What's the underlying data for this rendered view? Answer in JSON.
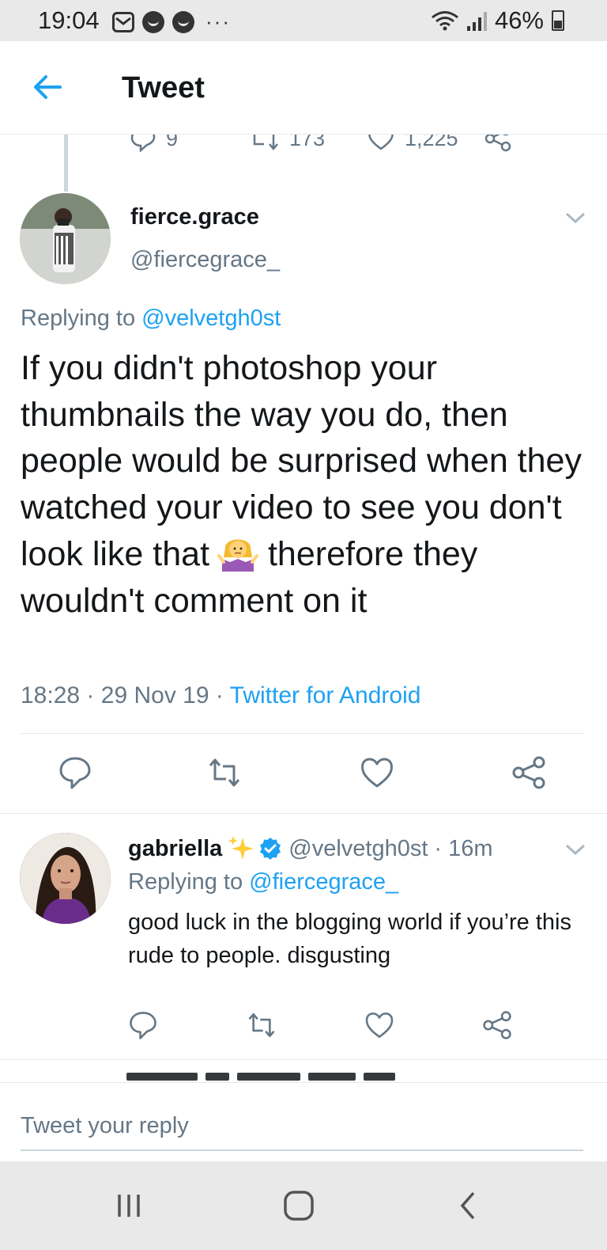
{
  "status_bar": {
    "time": "19:04",
    "icons": [
      "mail-icon",
      "messenger-icon",
      "chat-icon",
      "more-icon"
    ],
    "more": "···",
    "battery_percent": "46%"
  },
  "header": {
    "title": "Tweet",
    "back_icon": "arrow-left-icon"
  },
  "previous_tweet": {
    "replies": "9",
    "retweets": "173",
    "likes": "1,225"
  },
  "main_tweet": {
    "display_name": "fierce.grace",
    "handle": "@fiercegrace_",
    "replying_prefix": "Replying to",
    "replying_to": "@velvetgh0st",
    "text": "If you didn't photoshop your thumbnails the way you do, then people would be surprised when they watched your video to see you don't look like that",
    "text_end": "therefore they wouldn't comment on it",
    "emoji": "person-shrugging-emoji",
    "time": "18:28",
    "date": "29 Nov 19",
    "separator": "·",
    "client": "Twitter for Android"
  },
  "reply_tweet": {
    "display_name": "gabriella",
    "handle": "@velvetgh0st",
    "time_ago": "16m",
    "separator": "·",
    "replying_prefix": "Replying to",
    "replying_to": "@fiercegrace_",
    "text": "good luck in the blogging world if you’re this rude to people. disgusting"
  },
  "compose": {
    "placeholder": "Tweet your reply"
  },
  "colors": {
    "accent": "#1da1f2",
    "secondary_text": "#657786",
    "primary_text": "#14171a",
    "verified": "#1da1f2"
  }
}
